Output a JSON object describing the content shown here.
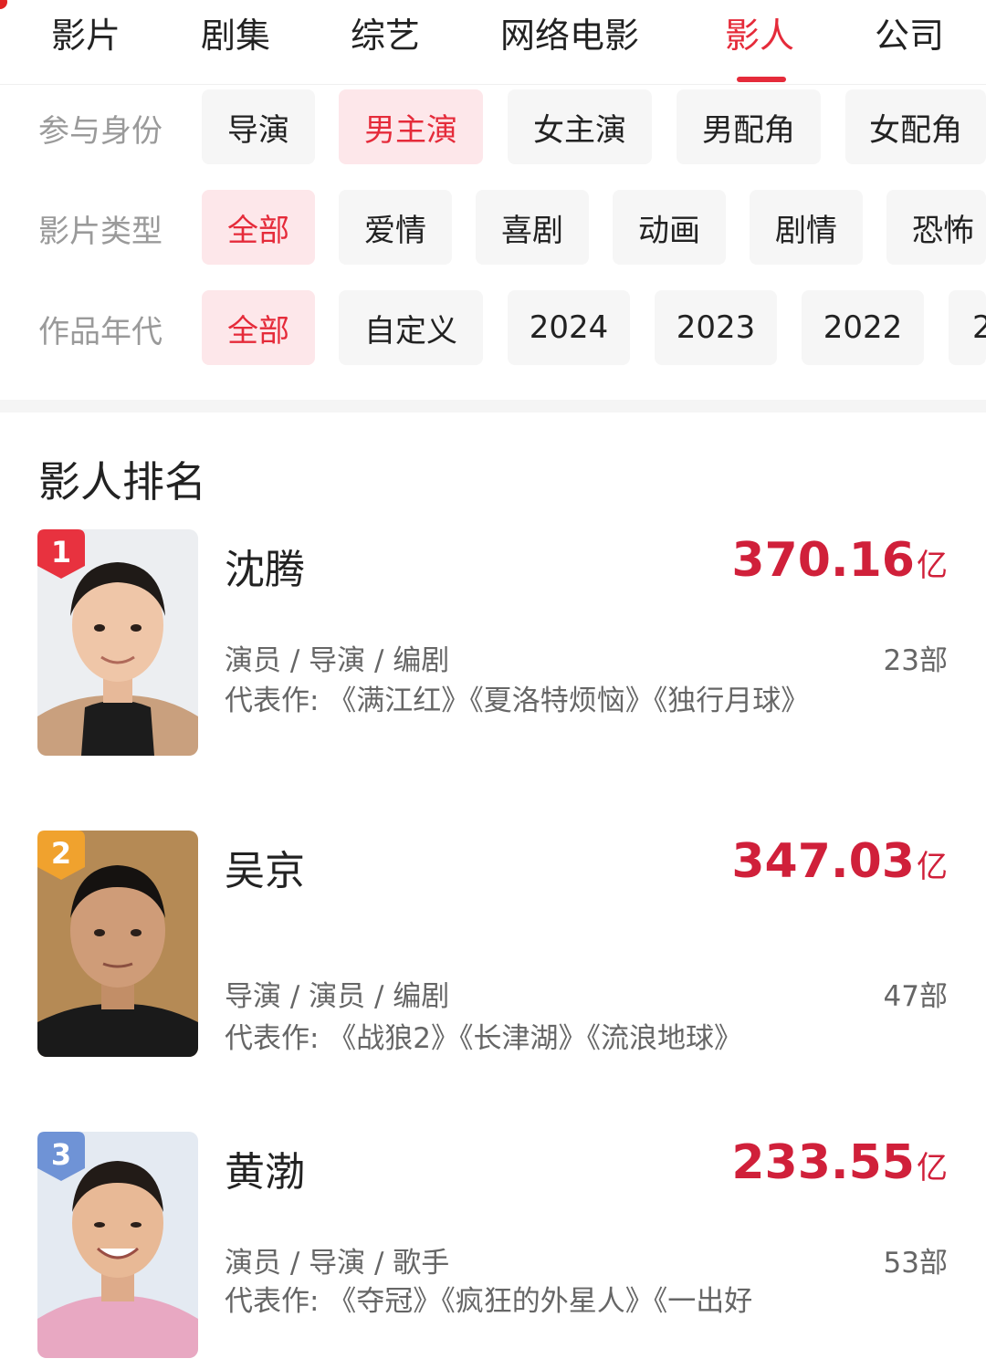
{
  "top_tabs": [
    {
      "label": "影片"
    },
    {
      "label": "剧集"
    },
    {
      "label": "综艺"
    },
    {
      "label": "网络电影"
    },
    {
      "label": "影人",
      "active": true
    },
    {
      "label": "公司"
    }
  ],
  "filters": {
    "role": {
      "label": "参与身份",
      "chips": [
        "导演",
        "男主演",
        "女主演",
        "男配角",
        "女配角"
      ],
      "selected": "男主演"
    },
    "genre": {
      "label": "影片类型",
      "chips": [
        "全部",
        "爱情",
        "喜剧",
        "动画",
        "剧情",
        "恐怖"
      ],
      "selected": "全部"
    },
    "year": {
      "label": "作品年代",
      "chips": [
        "全部",
        "自定义",
        "2024",
        "2023",
        "2022",
        "2"
      ],
      "selected": "全部"
    }
  },
  "section_title": "影人排名",
  "ranking": [
    {
      "rank": "1",
      "name": "沈腾",
      "box": "370.16",
      "unit": "亿",
      "roles": "演员 / 导演 / 编剧",
      "count": "23部",
      "works": "代表作: 《满江红》《夏洛特烦恼》《独行月球》"
    },
    {
      "rank": "2",
      "name": "吴京",
      "box": "347.03",
      "unit": "亿",
      "roles": "导演 / 演员 / 编剧",
      "count": "47部",
      "works": "代表作: 《战狼2》《长津湖》《流浪地球》"
    },
    {
      "rank": "3",
      "name": "黄渤",
      "box": "233.55",
      "unit": "亿",
      "roles": "演员 / 导演 / 歌手",
      "count": "53部",
      "works": "代表作: 《夺冠》《疯狂的外星人》《一出好"
    }
  ],
  "colors": {
    "accent": "#e52b3a",
    "rank1": "#e8323f",
    "rank2": "#f0a22e",
    "rank3": "#6f93d6"
  }
}
